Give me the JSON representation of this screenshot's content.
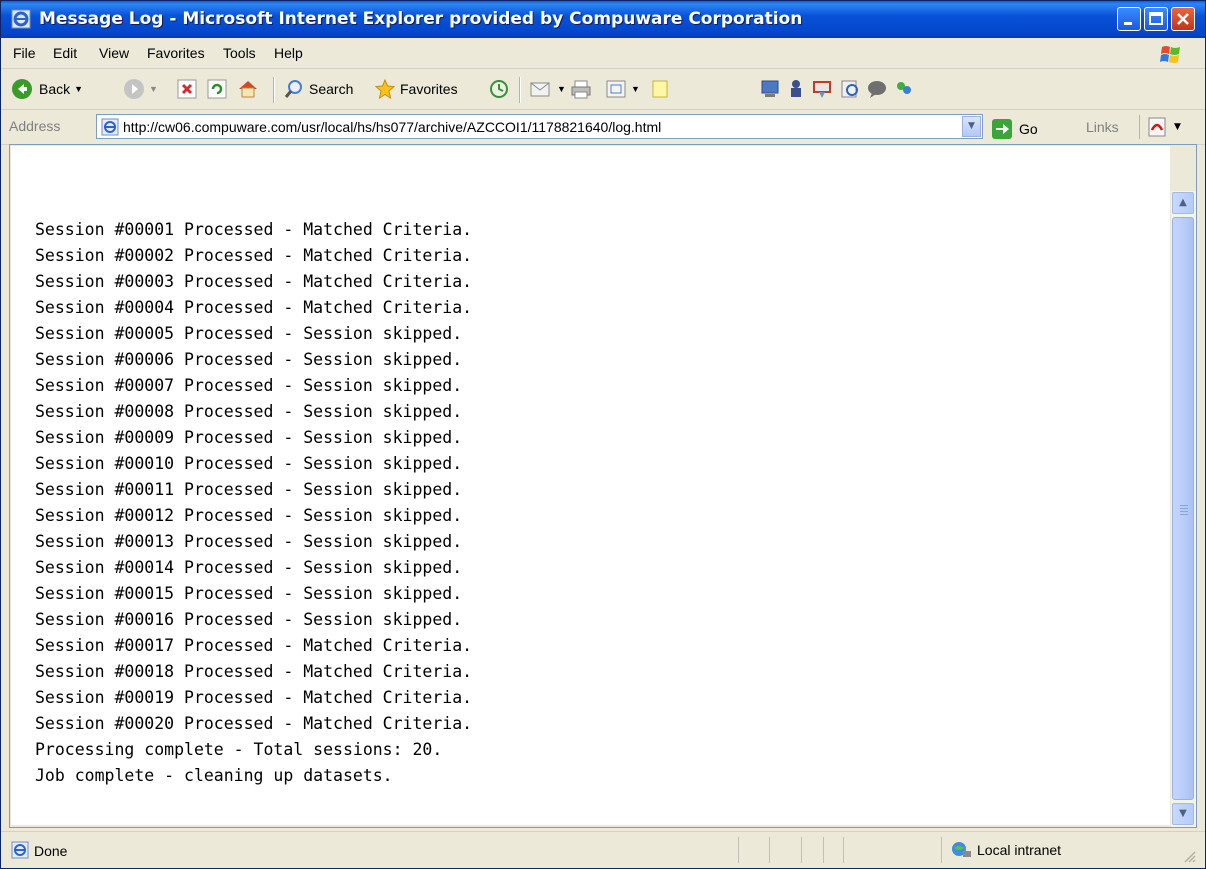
{
  "window": {
    "title": "Message Log - Microsoft Internet Explorer provided by Compuware Corporation",
    "icons": [
      "ie-icon",
      "minimize-icon",
      "maximize-icon",
      "close-icon"
    ]
  },
  "menu": {
    "items": [
      "File",
      "Edit",
      "View",
      "Favorites",
      "Tools",
      "Help"
    ]
  },
  "toolbar": {
    "back": "Back",
    "search": "Search",
    "favorites": "Favorites",
    "icons": [
      "back-icon",
      "forward-icon",
      "stop-icon",
      "refresh-icon",
      "home-icon",
      "search-icon",
      "favorites-icon",
      "history-icon",
      "mail-icon",
      "print-icon",
      "edit-icon",
      "discuss-icon",
      "messenger-icon",
      "research-icon",
      "tools-icon",
      "bookmark-icon",
      "chat-icon",
      "msn-icon"
    ]
  },
  "address": {
    "label": "Address",
    "url": "http://cw06.compuware.com/usr/local/hs/hs077/archive/AZCCOI1/1178821640/log.html",
    "go": "Go",
    "links": "Links"
  },
  "log": {
    "lines": [
      "Session #00001 Processed - Matched Criteria.",
      "Session #00002 Processed - Matched Criteria.",
      "Session #00003 Processed - Matched Criteria.",
      "Session #00004 Processed - Matched Criteria.",
      "Session #00005 Processed - Session skipped.",
      "Session #00006 Processed - Session skipped.",
      "Session #00007 Processed - Session skipped.",
      "Session #00008 Processed - Session skipped.",
      "Session #00009 Processed - Session skipped.",
      "Session #00010 Processed - Session skipped.",
      "Session #00011 Processed - Session skipped.",
      "Session #00012 Processed - Session skipped.",
      "Session #00013 Processed - Session skipped.",
      "Session #00014 Processed - Session skipped.",
      "Session #00015 Processed - Session skipped.",
      "Session #00016 Processed - Session skipped.",
      "Session #00017 Processed - Matched Criteria.",
      "Session #00018 Processed - Matched Criteria.",
      "Session #00019 Processed - Matched Criteria.",
      "Session #00020 Processed - Matched Criteria.",
      "Processing complete - Total sessions: 20.",
      "Job complete - cleaning up datasets."
    ]
  },
  "status": {
    "text": "Done",
    "zone": "Local intranet"
  },
  "colors": {
    "titlebar": "#0852d8",
    "chrome": "#ece9d8",
    "scroll_thumb": "#b9cef8"
  }
}
